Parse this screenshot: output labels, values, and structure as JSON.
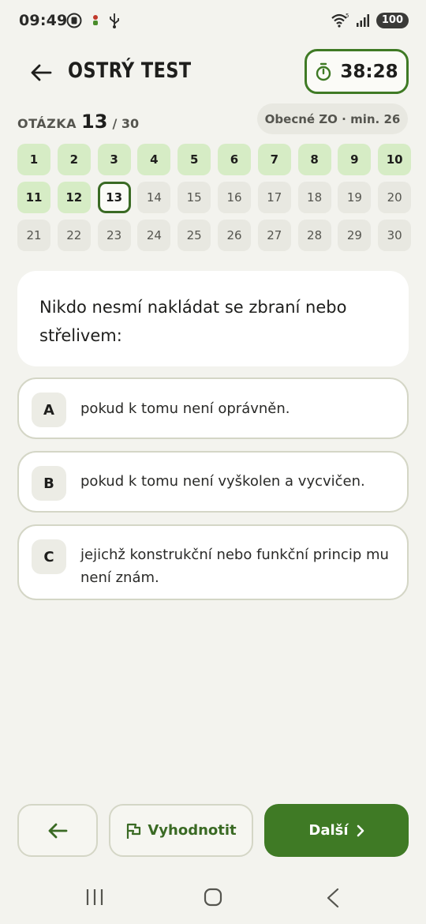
{
  "status_bar": {
    "time": "09:49",
    "battery": "100",
    "icons_left": [
      "record-icon",
      "bug-icon",
      "usb-icon"
    ],
    "icons_right": [
      "wifi-icon",
      "signal-icon"
    ]
  },
  "header": {
    "title": "OSTRÝ TEST",
    "timer": "38:28",
    "back_icon": "arrow-left-icon",
    "timer_icon": "stopwatch-icon"
  },
  "question_meta": {
    "label": "OTÁZKA",
    "current": "13",
    "total": "/ 30",
    "category": "Obecné ZO · min. 26"
  },
  "question_grid": [
    {
      "n": "1",
      "state": "answered"
    },
    {
      "n": "2",
      "state": "answered"
    },
    {
      "n": "3",
      "state": "answered"
    },
    {
      "n": "4",
      "state": "answered"
    },
    {
      "n": "5",
      "state": "answered"
    },
    {
      "n": "6",
      "state": "answered"
    },
    {
      "n": "7",
      "state": "answered"
    },
    {
      "n": "8",
      "state": "answered"
    },
    {
      "n": "9",
      "state": "answered"
    },
    {
      "n": "10",
      "state": "answered"
    },
    {
      "n": "11",
      "state": "answered"
    },
    {
      "n": "12",
      "state": "answered"
    },
    {
      "n": "13",
      "state": "current"
    },
    {
      "n": "14",
      "state": "empty"
    },
    {
      "n": "15",
      "state": "empty"
    },
    {
      "n": "16",
      "state": "empty"
    },
    {
      "n": "17",
      "state": "empty"
    },
    {
      "n": "18",
      "state": "empty"
    },
    {
      "n": "19",
      "state": "empty"
    },
    {
      "n": "20",
      "state": "empty"
    },
    {
      "n": "21",
      "state": "empty"
    },
    {
      "n": "22",
      "state": "empty"
    },
    {
      "n": "23",
      "state": "empty"
    },
    {
      "n": "24",
      "state": "empty"
    },
    {
      "n": "25",
      "state": "empty"
    },
    {
      "n": "26",
      "state": "empty"
    },
    {
      "n": "27",
      "state": "empty"
    },
    {
      "n": "28",
      "state": "empty"
    },
    {
      "n": "29",
      "state": "empty"
    },
    {
      "n": "30",
      "state": "empty"
    }
  ],
  "question": {
    "text": "Nikdo nesmí nakládat se zbraní nebo střelivem:"
  },
  "options": [
    {
      "letter": "A",
      "text": "pokud k tomu není oprávněn."
    },
    {
      "letter": "B",
      "text": "pokud k tomu není vyškolen a vycvičen."
    },
    {
      "letter": "C",
      "text": "jejichž konstrukční nebo funkční princip mu není znám."
    }
  ],
  "bottom_bar": {
    "prev_icon": "arrow-left-icon",
    "evaluate_label": "Vyhodnotit",
    "evaluate_icon": "flag-icon",
    "next_label": "Další",
    "next_icon": "chevron-right-icon"
  },
  "colors": {
    "accent": "#3f7a25",
    "answered": "#d6ecc5",
    "background": "#f3f3ee"
  }
}
